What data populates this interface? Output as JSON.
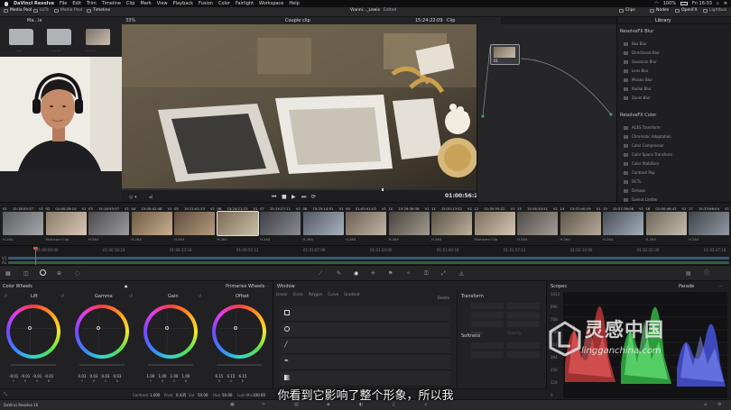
{
  "menubar": {
    "apple": "",
    "app_name": "DaVinci Resolve",
    "items": [
      "File",
      "Edit",
      "Trim",
      "Timeline",
      "Clip",
      "Mark",
      "View",
      "Playback",
      "Fusion",
      "Color",
      "Fairlight",
      "Workspace",
      "Help"
    ],
    "battery": "100%",
    "clock": "Fri 16:03"
  },
  "toolbar": {
    "media_pool": "Media Pool",
    "luts": "LUTs",
    "media_pool2": "Media Pool",
    "timeline": "Timeline",
    "project_title": "Vianni..._Lewis",
    "project_status": "Edited",
    "clips": "Clips",
    "nodes": "Nodes",
    "openfx": "OpenFX",
    "lightbox": "Lightbox"
  },
  "viewer": {
    "bin_label": "Ma...le",
    "zoom": "33%",
    "clip_name": "Couple clip",
    "header_timecode": "15:24:22:09",
    "mode": "Clip",
    "timecode": "01:00:56:23"
  },
  "node": {
    "label": "01"
  },
  "library": {
    "tab": "Library",
    "section1": "ResolveFX Blur",
    "blur_items": [
      "Box Blur",
      "Directional Blur",
      "Gaussian Blur",
      "Lens Blur",
      "Mosaic Blur",
      "Radial Blur",
      "Zoom Blur"
    ],
    "section2": "ResolveFX Color",
    "color_items": [
      "ACES Transform",
      "Chromatic Adaptation",
      "Color Compressor",
      "Color Space Transform",
      "Color Stabilizer",
      "Contrast Pop",
      "DCTL",
      "Dehaze",
      "Gamut Limiter"
    ]
  },
  "clips": [
    {
      "n": "01",
      "tc": "15:18:55:37",
      "v": "V1",
      "codec": "H.264"
    },
    {
      "n": "02",
      "tc": "01:00:26:10",
      "v": "V1",
      "codec": "Multicam Clip"
    },
    {
      "n": "03",
      "tc": "15:18:55:37",
      "v": "V1",
      "codec": "H.264"
    },
    {
      "n": "04",
      "tc": "15:50:42:48",
      "v": "V1",
      "codec": "H.264"
    },
    {
      "n": "05",
      "tc": "15:21:01:33",
      "v": "V1",
      "codec": "H.264"
    },
    {
      "n": "06",
      "tc": "15:24:21:23",
      "v": "V1",
      "codec": "H.264"
    },
    {
      "n": "07",
      "tc": "15:24:27:11",
      "v": "V1",
      "codec": "H.264"
    },
    {
      "n": "08",
      "tc": "15:25:14:51",
      "v": "V1",
      "codec": "H.264"
    },
    {
      "n": "09",
      "tc": "01:00:41:02",
      "v": "V1",
      "codec": "H.264"
    },
    {
      "n": "10",
      "tc": "15:26:36:38",
      "v": "V1",
      "codec": "H.264"
    },
    {
      "n": "11",
      "tc": "15:30:13:52",
      "v": "V1",
      "codec": "H.264"
    },
    {
      "n": "12",
      "tc": "01:00:55:22",
      "v": "V1",
      "codec": "Multicam Clip"
    },
    {
      "n": "13",
      "tc": "15:26:30:51",
      "v": "V1",
      "codec": "H.264"
    },
    {
      "n": "14",
      "tc": "15:07:40:19",
      "v": "V1",
      "codec": "H.264"
    },
    {
      "n": "15",
      "tc": "15:27:36:06",
      "v": "V1",
      "codec": "H.264"
    },
    {
      "n": "16",
      "tc": "01:00:46:42",
      "v": "V1",
      "codec": "H.264"
    },
    {
      "n": "17",
      "tc": "15:33:06:04",
      "v": "V1",
      "codec": "H.264"
    }
  ],
  "minitimeline": {
    "ticks": [
      "01:00:00:00",
      "01:00:16:24",
      "01:00:33:18",
      "01:00:50:12",
      "01:01:07:06",
      "01:01:24:00",
      "01:01:40:18",
      "01:01:57:12",
      "01:02:14:06",
      "01:02:31:00",
      "01:02:47:18"
    ],
    "tracks": [
      "V1",
      "A1"
    ]
  },
  "wheels": {
    "title": "Color Wheels",
    "mode": "Primaries Wheels",
    "names": [
      "Lift",
      "Gamma",
      "Gain",
      "Offset"
    ],
    "values": [
      [
        "-0.01",
        "-0.01",
        "-0.01",
        "-0.01"
      ],
      [
        "0.03",
        "0.03",
        "0.03",
        "0.03"
      ],
      [
        "1.00",
        "1.00",
        "1.00",
        "1.00"
      ],
      [
        "6.15",
        "6.15",
        "6.15",
        ""
      ]
    ],
    "channel_labels": [
      "Y",
      "R",
      "G",
      "B"
    ],
    "bottom": {
      "contrast_label": "Contrast",
      "contrast": "1.000",
      "pivot_label": "Pivot",
      "pivot": "0.435",
      "sat_label": "Sat",
      "sat": "50.00",
      "hue_label": "Hue",
      "hue": "50.00",
      "lummix_label": "Lum Mix",
      "lummix": "100.00"
    }
  },
  "window": {
    "title": "Window",
    "tools": [
      "Linear",
      "Circle",
      "Polygon",
      "Curve",
      "Gradient"
    ],
    "delete": "Delete",
    "transform": "Transform",
    "softness": "Softness",
    "transform_fields": [
      "Size",
      "Aspect",
      "Pan",
      "Tilt",
      "Rotate",
      "Opacity"
    ]
  },
  "scopes": {
    "title": "Scopes",
    "mode": "Parade",
    "scale": [
      "1023",
      "896",
      "768",
      "640",
      "512",
      "384",
      "256",
      "128",
      "0"
    ]
  },
  "subtitle": "你看到它影响了整个形象，所以我",
  "watermark": {
    "cn": "灵感中国",
    "url": "lingganchina.com"
  },
  "pagebar": {
    "app": "DaVinci Resolve 16"
  }
}
